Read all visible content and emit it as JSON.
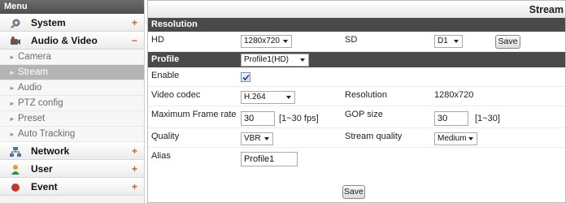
{
  "sidebar": {
    "header": "Menu",
    "sections": {
      "system": {
        "label": "System",
        "toggle": "+"
      },
      "audio_video": {
        "label": "Audio & Video",
        "toggle": "−"
      },
      "network": {
        "label": "Network",
        "toggle": "+"
      },
      "user": {
        "label": "User",
        "toggle": "+"
      },
      "event": {
        "label": "Event",
        "toggle": "+"
      }
    },
    "sub_items": [
      "Camera",
      "Stream",
      "Audio",
      "PTZ config",
      "Preset",
      "Auto Tracking"
    ],
    "active_sub_item": "Stream",
    "icons": {
      "system": "wrench-gear-icon",
      "audio_video": "camera-icon",
      "network": "network-icon",
      "user": "user-icon",
      "event": "event-icon"
    }
  },
  "page": {
    "title": "Stream"
  },
  "resolution_section": {
    "title": "Resolution",
    "hd_label": "HD",
    "hd_value": "1280x720",
    "sd_label": "SD",
    "sd_value": "D1",
    "save_label": "Save"
  },
  "profile_section": {
    "title": "Profile",
    "profile_value": "Profile1(HD)",
    "enable_label": "Enable",
    "enable_checked": true,
    "video_codec_label": "Video codec",
    "video_codec_value": "H.264",
    "resolution_label": "Resolution",
    "resolution_value": "1280x720",
    "max_frame_rate_label": "Maximum Frame rate",
    "max_frame_rate_value": "30",
    "max_frame_rate_range": "[1~30 fps]",
    "gop_size_label": "GOP size",
    "gop_size_value": "30",
    "gop_size_range": "[1~30]",
    "quality_label": "Quality",
    "quality_value": "VBR",
    "stream_quality_label": "Stream quality",
    "stream_quality_value": "Medium",
    "alias_label": "Alias",
    "alias_value": "Profile1",
    "save_label": "Save"
  }
}
